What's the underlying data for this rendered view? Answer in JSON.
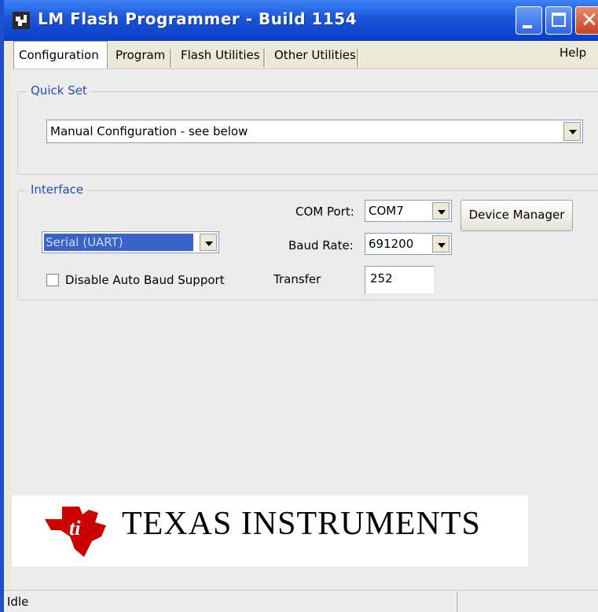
{
  "window": {
    "title": "LM Flash Programmer - Build 1154",
    "colors": {
      "titlebar": "#1a55d8",
      "close": "#c9401f",
      "accent_text": "#1f4fb8"
    }
  },
  "tabs": [
    {
      "label": "Configuration",
      "active": true
    },
    {
      "label": "Program",
      "active": false
    },
    {
      "label": "Flash Utilities",
      "active": false
    },
    {
      "label": "Other Utilities",
      "active": false
    }
  ],
  "help_label": "Help",
  "quick_set": {
    "legend": "Quick Set",
    "selected": "Manual Configuration - see below"
  },
  "interface": {
    "legend": "Interface",
    "type_selected": "Serial (UART)",
    "com_port_label": "COM Port:",
    "com_port_value": "COM7",
    "baud_rate_label": "Baud Rate:",
    "baud_rate_value": "691200",
    "transfer_label": "Transfer",
    "transfer_value": "252",
    "device_manager_label": "Device Manager",
    "auto_baud_label": "Disable Auto Baud Support",
    "auto_baud_checked": false
  },
  "logo": {
    "text": "TEXAS INSTRUMENTS",
    "icon": "ti-logo-icon",
    "color": "#cc0000"
  },
  "status": {
    "text": "Idle"
  }
}
